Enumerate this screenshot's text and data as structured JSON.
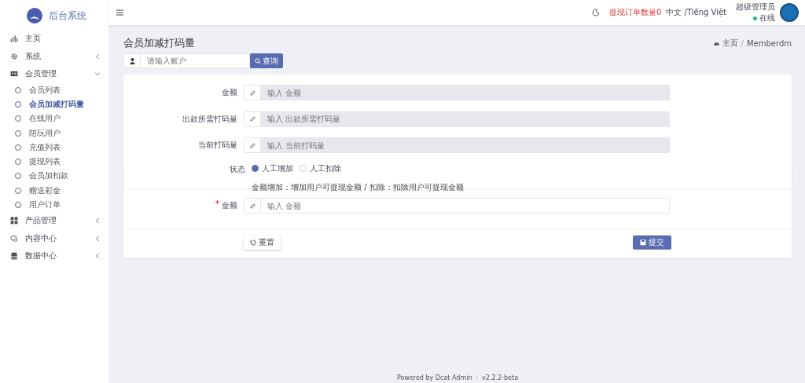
{
  "brand": {
    "title": "后台系统"
  },
  "sidebar": {
    "items": [
      {
        "label": "主页"
      },
      {
        "label": "系统",
        "expanded": false
      },
      {
        "label": "会员管理",
        "expanded": true,
        "children": [
          {
            "label": "会员列表",
            "selected": false
          },
          {
            "label": "会员加减打码量",
            "selected": true
          },
          {
            "label": "在线用户",
            "selected": false
          },
          {
            "label": "陪玩用户",
            "selected": false
          },
          {
            "label": "充值列表",
            "selected": false
          },
          {
            "label": "提现列表",
            "selected": false
          },
          {
            "label": "会员加扣款",
            "selected": false
          },
          {
            "label": "赠送彩金",
            "selected": false
          },
          {
            "label": "用户订单",
            "selected": false
          }
        ]
      },
      {
        "label": "产品管理",
        "expanded": false
      },
      {
        "label": "内容中心",
        "expanded": false
      },
      {
        "label": "数据中心",
        "expanded": false
      }
    ]
  },
  "topbar": {
    "withdraw_orders": "提现订单数量0",
    "language": "中文 /Tiếng Việt",
    "user": "超级管理员",
    "status": "在线"
  },
  "page": {
    "title": "会员加减打码量",
    "breadcrumb": [
      "主页",
      "Memberdm"
    ],
    "breadcrumb_separator": "/"
  },
  "search": {
    "placeholder": "请输入账户",
    "button": "查询"
  },
  "form": {
    "fields": [
      {
        "kind": "input",
        "label": "金额",
        "placeholder": "输入 金额",
        "required": false,
        "disabled": true
      },
      {
        "kind": "input",
        "label": "出款所需打码量",
        "placeholder": "输入 出款所需打码量",
        "required": false,
        "disabled": true
      },
      {
        "kind": "input",
        "label": "当前打码量",
        "placeholder": "输入 当前打码量",
        "required": false,
        "disabled": true
      },
      {
        "kind": "radio",
        "label": "状态",
        "options": [
          {
            "label": "人工增加",
            "selected": true
          },
          {
            "label": "人工扣除",
            "selected": false
          }
        ],
        "help": "金额增加：增加用户可提现金额 / 扣除：扣除用户可提现金额"
      },
      {
        "kind": "input",
        "label": "金额",
        "placeholder": "输入 金额",
        "required": true,
        "disabled": false
      }
    ],
    "reset": "重置",
    "submit": "提交"
  },
  "footer": {
    "powered": "Powered by Dcat Admin",
    "separator": "·",
    "version": "v2.2.2-beta"
  }
}
